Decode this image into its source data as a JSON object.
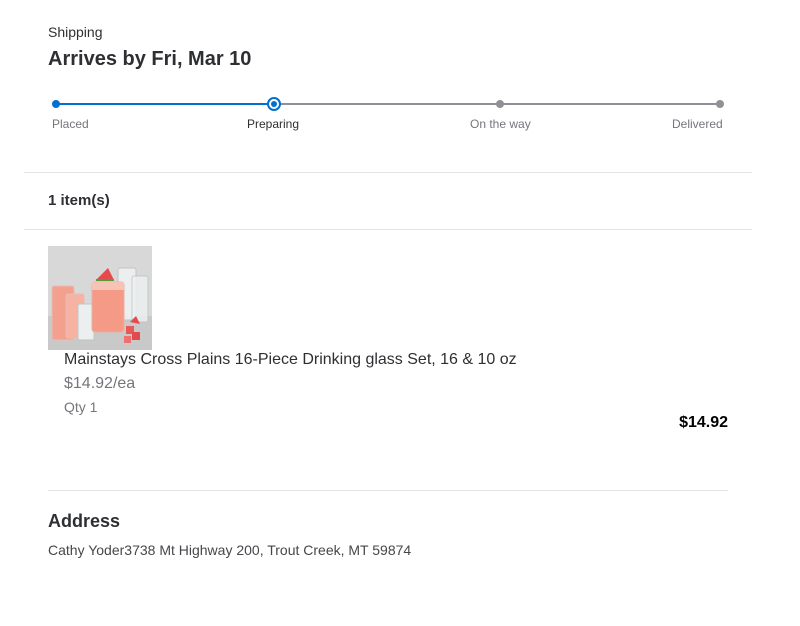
{
  "shipping": {
    "label": "Shipping",
    "arrival": "Arrives by Fri, Mar 10"
  },
  "tracker": {
    "steps": [
      {
        "label": "Placed",
        "state": "done"
      },
      {
        "label": "Preparing",
        "state": "current"
      },
      {
        "label": "On the way",
        "state": "todo"
      },
      {
        "label": "Delivered",
        "state": "todo"
      }
    ],
    "colors": {
      "active": "#0071ce",
      "inactive": "#909196"
    }
  },
  "items": {
    "count_label": "1 item(s)",
    "list": [
      {
        "name": "Mainstays Cross Plains 16-Piece Drinking glass Set, 16 & 10 oz",
        "unit_price": "$14.92/ea",
        "qty": "Qty 1",
        "total": "$14.92",
        "image_icon": "drinking-glasses-photo"
      }
    ]
  },
  "address": {
    "title": "Address",
    "text": "Cathy Yoder3738 Mt Highway 200, Trout Creek, MT 59874"
  }
}
